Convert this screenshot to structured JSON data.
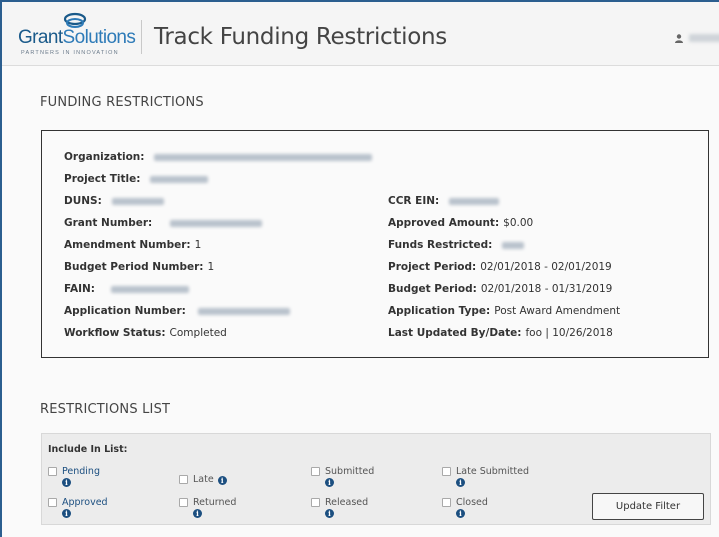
{
  "header": {
    "logo_grant": "Grant",
    "logo_solutions": "Solutions",
    "logo_tagline": "PARTNERS IN INNOVATION",
    "page_title": "Track Funding Restrictions",
    "user_icon": "user-icon"
  },
  "funding": {
    "section_title": "FUNDING RESTRICTIONS",
    "left_fields": [
      {
        "label": "Organization:",
        "value": ""
      },
      {
        "label": "Project Title:",
        "value": ""
      },
      {
        "label": "DUNS:",
        "value": ""
      },
      {
        "label": "Grant Number:",
        "value": ""
      },
      {
        "label": "Amendment Number:",
        "value": "1"
      },
      {
        "label": "Budget Period Number:",
        "value": "1"
      },
      {
        "label": "FAIN:",
        "value": ""
      },
      {
        "label": "Application Number:",
        "value": ""
      },
      {
        "label": "Workflow Status:",
        "value": "Completed"
      }
    ],
    "right_fields": [
      {
        "label": "CCR EIN:",
        "value": ""
      },
      {
        "label": "Approved Amount:",
        "value": "$0.00"
      },
      {
        "label": "Funds Restricted:",
        "value": ""
      },
      {
        "label": "Project Period:",
        "value": "02/01/2018 - 02/01/2019"
      },
      {
        "label": "Budget Period:",
        "value": "02/01/2018 - 01/31/2019"
      },
      {
        "label": "Application Type:",
        "value": "Post Award Amendment"
      },
      {
        "label": "Last Updated By/Date:",
        "value": "foo | 10/26/2018"
      }
    ]
  },
  "restrictions": {
    "section_title": "RESTRICTIONS LIST",
    "include_label": "Include In List:",
    "options": {
      "pending": "Pending",
      "late": "Late",
      "submitted": "Submitted",
      "late_submitted": "Late Submitted",
      "approved": "Approved",
      "returned": "Returned",
      "released": "Released",
      "closed": "Closed"
    },
    "info_glyph": "i",
    "update_button": "Update Filter"
  },
  "colors": {
    "accent": "#2b5e8f",
    "info_icon": "#1c4f80"
  }
}
